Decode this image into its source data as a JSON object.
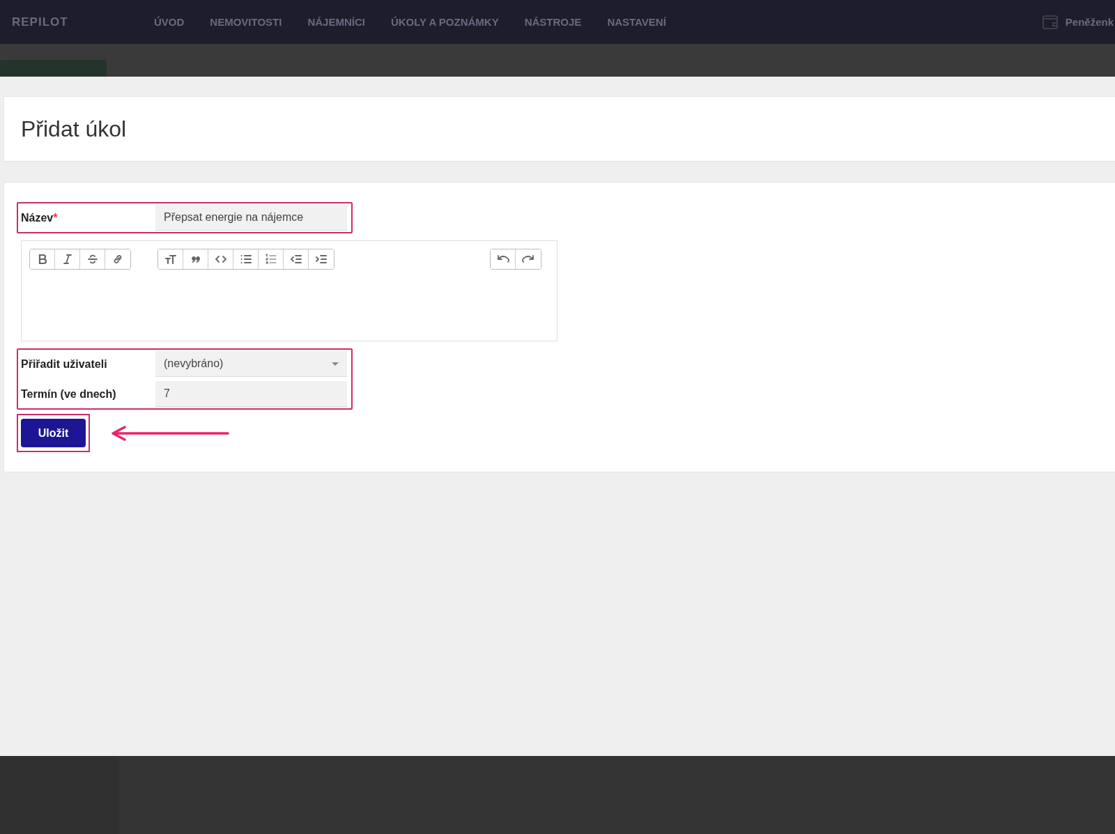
{
  "nav": {
    "logo": "REPILOT",
    "items": [
      "ÚVOD",
      "NEMOVITOSTI",
      "NÁJEMNÍCI",
      "ÚKOLY A POZNÁMKY",
      "NÁSTROJE",
      "NASTAVENÍ"
    ],
    "wallet": "Peněženk"
  },
  "modal": {
    "title": "Přidat úkol",
    "groups": [
      {
        "highlighted": true,
        "fields": [
          {
            "kind": "text",
            "label": "Název",
            "required_mark": "*",
            "value": "Přepsat energie na nájemce"
          }
        ]
      },
      {
        "highlighted": false,
        "fields": [
          {
            "kind": "editor"
          }
        ]
      },
      {
        "highlighted": true,
        "fields": [
          {
            "kind": "select",
            "label": "Přiřadit uživateli",
            "value": "(nevybráno)"
          },
          {
            "kind": "text",
            "label": "Termín (ve dnech)",
            "value": "7"
          }
        ]
      }
    ],
    "save": {
      "label": "Uložit",
      "highlighted": true
    }
  }
}
